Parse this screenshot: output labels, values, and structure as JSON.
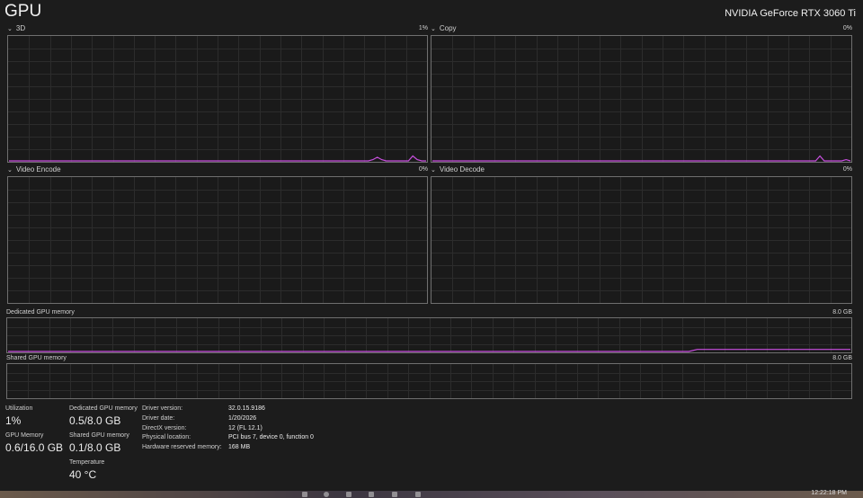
{
  "header": {
    "title": "GPU",
    "gpu_name": "NVIDIA GeForce RTX 3060 Ti"
  },
  "engines": [
    {
      "label": "3D",
      "percent": "1%",
      "activity": [
        0,
        0,
        0,
        0,
        0,
        0,
        0,
        0,
        0,
        0,
        0,
        0,
        0,
        0,
        0,
        0,
        0,
        0,
        0,
        0,
        0,
        0,
        0,
        0,
        0,
        0,
        0,
        0,
        0,
        0,
        0,
        0,
        0,
        0,
        0,
        0,
        0,
        0,
        0,
        0,
        0,
        0,
        0,
        0,
        0,
        0,
        0,
        0,
        0,
        0,
        0,
        0,
        0,
        0,
        0,
        0,
        0,
        0,
        0,
        0,
        0,
        0,
        0,
        0,
        0,
        0,
        0,
        0,
        0,
        0,
        0,
        0,
        0,
        0,
        0,
        0,
        0,
        0,
        0,
        0,
        0,
        0,
        1,
        3,
        1,
        0,
        0,
        0,
        0,
        0,
        0,
        4,
        1,
        0,
        0
      ]
    },
    {
      "label": "Copy",
      "percent": "0%",
      "activity": [
        0,
        0,
        0,
        0,
        0,
        0,
        0,
        0,
        0,
        0,
        0,
        0,
        0,
        0,
        0,
        0,
        0,
        0,
        0,
        0,
        0,
        0,
        0,
        0,
        0,
        0,
        0,
        0,
        0,
        0,
        0,
        0,
        0,
        0,
        0,
        0,
        0,
        0,
        0,
        0,
        0,
        0,
        0,
        0,
        0,
        0,
        0,
        0,
        0,
        0,
        0,
        0,
        0,
        0,
        0,
        0,
        0,
        0,
        0,
        0,
        0,
        0,
        0,
        0,
        0,
        0,
        0,
        0,
        0,
        0,
        0,
        0,
        0,
        0,
        0,
        0,
        0,
        0,
        0,
        0,
        0,
        0,
        0,
        0,
        0,
        0,
        0,
        0,
        0,
        4,
        0,
        0,
        0,
        0,
        0,
        1,
        0
      ]
    },
    {
      "label": "Video Encode",
      "percent": "0%",
      "activity": []
    },
    {
      "label": "Video Decode",
      "percent": "0%",
      "activity": []
    }
  ],
  "memory_graphs": {
    "dedicated": {
      "label": "Dedicated GPU memory",
      "max": "8.0 GB",
      "usage": [
        0,
        0,
        0,
        0,
        0,
        0,
        0,
        0,
        0,
        0,
        0,
        0,
        0,
        0,
        0,
        0,
        0,
        0,
        0,
        0,
        0,
        0,
        0,
        0,
        0,
        0,
        0,
        0,
        0,
        0,
        0,
        0,
        0,
        0,
        0,
        0,
        0,
        0,
        0,
        0,
        0,
        0,
        0,
        0,
        0,
        0,
        0,
        0,
        0,
        0,
        0,
        0,
        0,
        0,
        0,
        0,
        0,
        0,
        0,
        0,
        0,
        0,
        0,
        0,
        0,
        0,
        0,
        0,
        0,
        0,
        0,
        0,
        0,
        0,
        0,
        0,
        0,
        0,
        0,
        0,
        0,
        6.3,
        6.3,
        6.3,
        6.3,
        6.3,
        6.3,
        6.3,
        6.3,
        6.3,
        6.3,
        6.3,
        6.3,
        6.3,
        6.3,
        6.3,
        6.3,
        6.3,
        6.3,
        6.3
      ]
    },
    "shared": {
      "label": "Shared GPU memory",
      "max": "8.0 GB",
      "usage": []
    }
  },
  "stats": {
    "utilization": {
      "label": "Utilization",
      "value": "1%"
    },
    "gpu_memory": {
      "label": "GPU Memory",
      "value": "0.6/16.0 GB"
    },
    "dedicated_memory": {
      "label": "Dedicated GPU memory",
      "value": "0.5/8.0 GB"
    },
    "shared_memory": {
      "label": "Shared GPU memory",
      "value": "0.1/8.0 GB"
    },
    "temperature": {
      "label": "Temperature",
      "value": "40 °C"
    }
  },
  "info": [
    {
      "label": "Driver version:",
      "value": "32.0.15.9186"
    },
    {
      "label": "Driver date:",
      "value": "1/20/2026"
    },
    {
      "label": "DirectX version:",
      "value": "12 (FL 12.1)"
    },
    {
      "label": "Physical location:",
      "value": "PCI bus 7, device 0, function 0"
    },
    {
      "label": "Hardware reserved memory:",
      "value": "168 MB"
    }
  ],
  "colors": {
    "accent": "#c94fe0",
    "grid": "#2c2c2c",
    "border": "#6f6f6f"
  },
  "taskbar": {
    "clock": "12:22:18 PM"
  }
}
